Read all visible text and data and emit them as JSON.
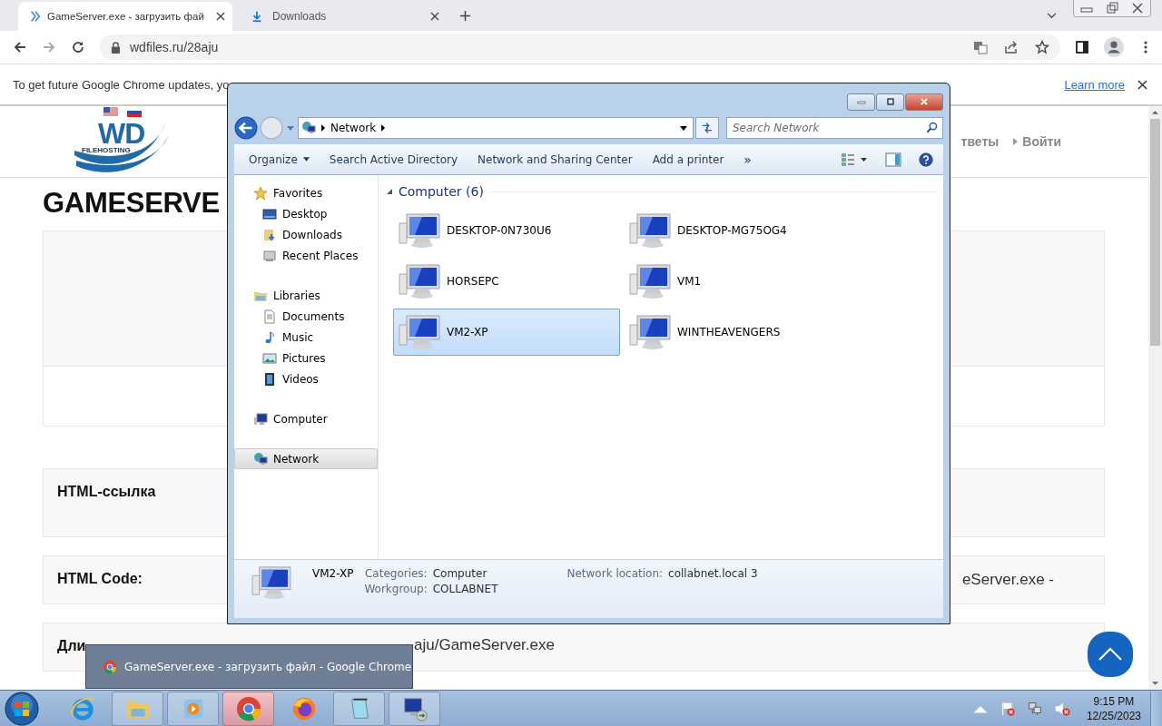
{
  "browser": {
    "tabs": [
      {
        "title": "GameServer.exe - загрузить фай",
        "kind": "site",
        "selected": true
      },
      {
        "title": "Downloads",
        "kind": "download",
        "selected": false
      }
    ],
    "url": "wdfiles.ru/28aju",
    "infobar": {
      "message": "To get future Google Chrome updates, yo",
      "link": "Learn more"
    }
  },
  "site": {
    "logo": {
      "mark": "WD",
      "caption": "FILEHOSTING"
    },
    "nav": [
      "тветы",
      "Войти"
    ],
    "heading": "GAMESERVE",
    "rows": [
      {
        "label": "HTML-ссылка"
      },
      {
        "label": "HTML Code:",
        "value": "eServer.exe -"
      },
      {
        "label": "Дли",
        "value": "aju/GameServer.exe"
      }
    ]
  },
  "explorer": {
    "address": "Network",
    "search": {
      "placeholder": "Search Network"
    },
    "toolbar": [
      {
        "label": "Organize",
        "menu": true
      },
      {
        "label": "Search Active Directory",
        "menu": false
      },
      {
        "label": "Network and Sharing Center",
        "menu": false
      },
      {
        "label": "Add a printer",
        "menu": false
      }
    ],
    "toolbar_more": "»",
    "nav": [
      {
        "label": "Favorites",
        "kind": "star",
        "selected": false,
        "children": [
          {
            "label": "Desktop",
            "kind": "desktop",
            "selected": false
          },
          {
            "label": "Downloads",
            "kind": "downloads",
            "selected": false
          },
          {
            "label": "Recent Places",
            "kind": "recent",
            "selected": false
          }
        ]
      },
      {
        "label": "Libraries",
        "kind": "library",
        "selected": false,
        "children": [
          {
            "label": "Documents",
            "kind": "document",
            "selected": false
          },
          {
            "label": "Music",
            "kind": "music",
            "selected": false
          },
          {
            "label": "Pictures",
            "kind": "picture",
            "selected": false
          },
          {
            "label": "Videos",
            "kind": "video",
            "selected": false
          }
        ]
      },
      {
        "label": "Computer",
        "kind": "computer",
        "selected": false
      },
      {
        "label": "Network",
        "kind": "network",
        "selected": true
      }
    ],
    "group": {
      "label": "Computer (6)",
      "expanded": true
    },
    "computers": [
      {
        "name": "DESKTOP-0N730U6",
        "selected": false
      },
      {
        "name": "DESKTOP-MG75OG4",
        "selected": false
      },
      {
        "name": "HORSEPC",
        "selected": false
      },
      {
        "name": "VM1",
        "selected": false
      },
      {
        "name": "VM2-XP",
        "selected": true
      },
      {
        "name": "WINTHEAVENGERS",
        "selected": false
      }
    ],
    "details": {
      "name": "VM2-XP",
      "columns": [
        [
          {
            "label": "Categories:",
            "value": "Computer"
          },
          {
            "label": "Workgroup:",
            "value": "COLLABNET"
          }
        ],
        [
          {
            "label": "Network location:",
            "value": "collabnet.local  3"
          }
        ]
      ]
    }
  },
  "tooltip": {
    "title": "GameServer.exe - загрузить файл - Google Chrome"
  },
  "taskbar": {
    "apps": [
      {
        "kind": "ie",
        "running": false,
        "active": false
      },
      {
        "kind": "folder",
        "running": true,
        "active": false
      },
      {
        "kind": "media",
        "running": true,
        "active": false
      },
      {
        "kind": "chrome",
        "running": true,
        "active": true
      },
      {
        "kind": "firefox",
        "running": false,
        "active": false
      },
      {
        "kind": "notepad",
        "running": true,
        "active": false
      },
      {
        "kind": "remote",
        "running": true,
        "active": false
      }
    ],
    "time": "9:15 PM",
    "date": "12/25/2023"
  }
}
